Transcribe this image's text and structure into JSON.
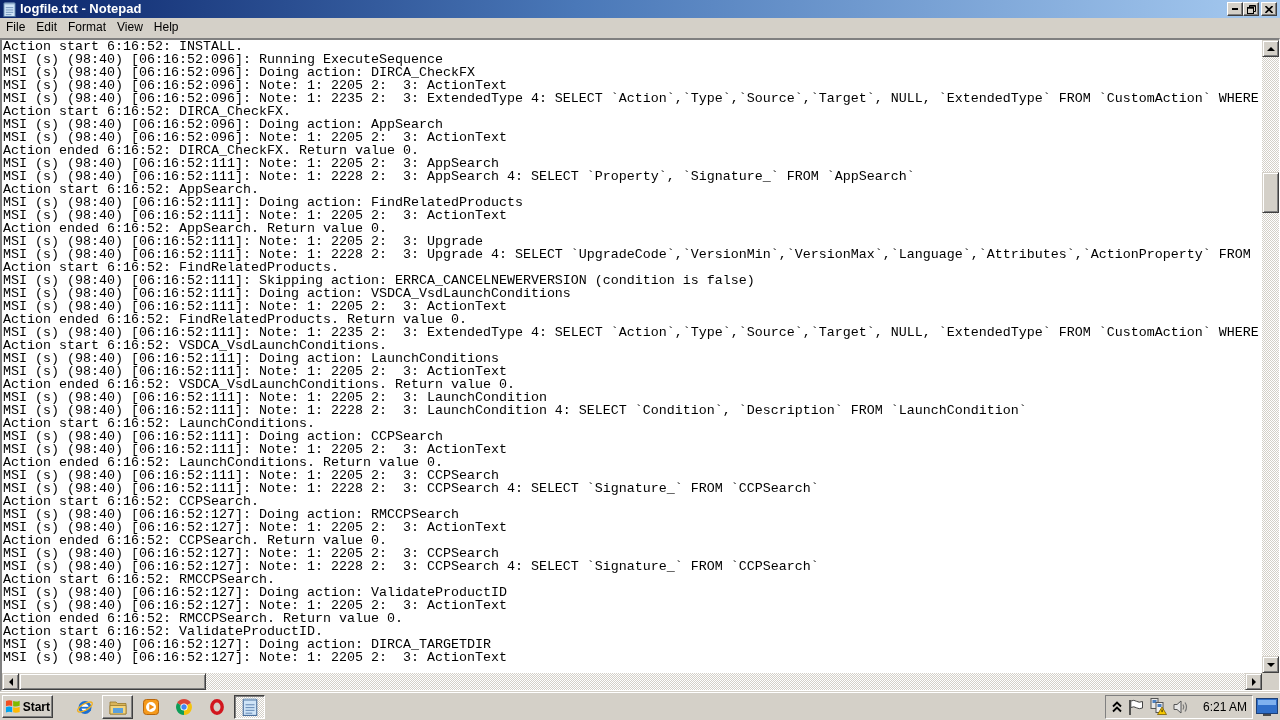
{
  "window": {
    "title": "logfile.txt - Notepad"
  },
  "menu_bar": [
    "File",
    "Edit",
    "Format",
    "View",
    "Help"
  ],
  "document": {
    "lines": [
      "Action start 6:16:52: INSTALL.",
      "MSI (s) (98:40) [06:16:52:096]: Running ExecuteSequence",
      "MSI (s) (98:40) [06:16:52:096]: Doing action: DIRCA_CheckFX",
      "MSI (s) (98:40) [06:16:52:096]: Note: 1: 2205 2:  3: ActionText",
      "MSI (s) (98:40) [06:16:52:096]: Note: 1: 2235 2:  3: ExtendedType 4: SELECT `Action`,`Type`,`Source`,`Target`, NULL, `ExtendedType` FROM `CustomAction` WHERE",
      "Action start 6:16:52: DIRCA_CheckFX.",
      "MSI (s) (98:40) [06:16:52:096]: Doing action: AppSearch",
      "MSI (s) (98:40) [06:16:52:096]: Note: 1: 2205 2:  3: ActionText",
      "Action ended 6:16:52: DIRCA_CheckFX. Return value 0.",
      "MSI (s) (98:40) [06:16:52:111]: Note: 1: 2205 2:  3: AppSearch",
      "MSI (s) (98:40) [06:16:52:111]: Note: 1: 2228 2:  3: AppSearch 4: SELECT `Property`, `Signature_` FROM `AppSearch`",
      "Action start 6:16:52: AppSearch.",
      "MSI (s) (98:40) [06:16:52:111]: Doing action: FindRelatedProducts",
      "MSI (s) (98:40) [06:16:52:111]: Note: 1: 2205 2:  3: ActionText",
      "Action ended 6:16:52: AppSearch. Return value 0.",
      "MSI (s) (98:40) [06:16:52:111]: Note: 1: 2205 2:  3: Upgrade",
      "MSI (s) (98:40) [06:16:52:111]: Note: 1: 2228 2:  3: Upgrade 4: SELECT `UpgradeCode`,`VersionMin`,`VersionMax`,`Language`,`Attributes`,`ActionProperty` FROM",
      "Action start 6:16:52: FindRelatedProducts.",
      "MSI (s) (98:40) [06:16:52:111]: Skipping action: ERRCA_CANCELNEWERVERSION (condition is false)",
      "MSI (s) (98:40) [06:16:52:111]: Doing action: VSDCA_VsdLaunchConditions",
      "MSI (s) (98:40) [06:16:52:111]: Note: 1: 2205 2:  3: ActionText",
      "Action ended 6:16:52: FindRelatedProducts. Return value 0.",
      "MSI (s) (98:40) [06:16:52:111]: Note: 1: 2235 2:  3: ExtendedType 4: SELECT `Action`,`Type`,`Source`,`Target`, NULL, `ExtendedType` FROM `CustomAction` WHERE",
      "Action start 6:16:52: VSDCA_VsdLaunchConditions.",
      "MSI (s) (98:40) [06:16:52:111]: Doing action: LaunchConditions",
      "MSI (s) (98:40) [06:16:52:111]: Note: 1: 2205 2:  3: ActionText",
      "Action ended 6:16:52: VSDCA_VsdLaunchConditions. Return value 0.",
      "MSI (s) (98:40) [06:16:52:111]: Note: 1: 2205 2:  3: LaunchCondition",
      "MSI (s) (98:40) [06:16:52:111]: Note: 1: 2228 2:  3: LaunchCondition 4: SELECT `Condition`, `Description` FROM `LaunchCondition`",
      "Action start 6:16:52: LaunchConditions.",
      "MSI (s) (98:40) [06:16:52:111]: Doing action: CCPSearch",
      "MSI (s) (98:40) [06:16:52:111]: Note: 1: 2205 2:  3: ActionText",
      "Action ended 6:16:52: LaunchConditions. Return value 0.",
      "MSI (s) (98:40) [06:16:52:111]: Note: 1: 2205 2:  3: CCPSearch",
      "MSI (s) (98:40) [06:16:52:111]: Note: 1: 2228 2:  3: CCPSearch 4: SELECT `Signature_` FROM `CCPSearch`",
      "Action start 6:16:52: CCPSearch.",
      "MSI (s) (98:40) [06:16:52:127]: Doing action: RMCCPSearch",
      "MSI (s) (98:40) [06:16:52:127]: Note: 1: 2205 2:  3: ActionText",
      "Action ended 6:16:52: CCPSearch. Return value 0.",
      "MSI (s) (98:40) [06:16:52:127]: Note: 1: 2205 2:  3: CCPSearch",
      "MSI (s) (98:40) [06:16:52:127]: Note: 1: 2228 2:  3: CCPSearch 4: SELECT `Signature_` FROM `CCPSearch`",
      "Action start 6:16:52: RMCCPSearch.",
      "MSI (s) (98:40) [06:16:52:127]: Doing action: ValidateProductID",
      "MSI (s) (98:40) [06:16:52:127]: Note: 1: 2205 2:  3: ActionText",
      "Action ended 6:16:52: RMCCPSearch. Return value 0.",
      "Action start 6:16:52: ValidateProductID.",
      "MSI (s) (98:40) [06:16:52:127]: Doing action: DIRCA_TARGETDIR",
      "MSI (s) (98:40) [06:16:52:127]: Note: 1: 2205 2:  3: ActionText"
    ]
  },
  "taskbar": {
    "start": "Start",
    "apps": [
      {
        "kind": "ebrowser",
        "running": false,
        "selected": false
      },
      {
        "kind": "folder",
        "running": true,
        "selected": false
      },
      {
        "kind": "player",
        "running": false,
        "selected": false
      },
      {
        "kind": "circlebrowser",
        "running": false,
        "selected": false
      },
      {
        "kind": "ring",
        "running": false,
        "selected": false
      },
      {
        "kind": "notepad",
        "running": true,
        "selected": true
      }
    ],
    "clock": "6:21 AM"
  }
}
